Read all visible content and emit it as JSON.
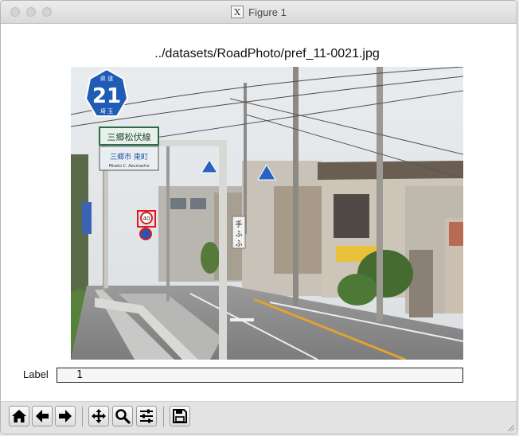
{
  "window": {
    "title": "Figure 1",
    "title_icon_glyph": "X"
  },
  "figure": {
    "title": "../datasets/RoadPhoto/pref_11-0021.jpg",
    "photo_description_name": "road-photo",
    "sign_text": {
      "route_top": "県 道",
      "route_number": "21",
      "route_bottom": "埼 玉",
      "sign_line1": "三郷松伏線",
      "sign_line2": "三郷市 東町",
      "sign_line3": "Misato C. Azumacho",
      "speed": "40",
      "side_sign1": "手",
      "side_sign2": "ふ",
      "side_sign3": "ふ"
    },
    "detection_box_color": "#e8141c"
  },
  "label": {
    "caption": "Label",
    "value": "1"
  },
  "toolbar": {
    "buttons": [
      {
        "name": "home-button",
        "icon": "home-icon"
      },
      {
        "name": "back-button",
        "icon": "arrow-left-icon"
      },
      {
        "name": "forward-button",
        "icon": "arrow-right-icon"
      },
      {
        "name": "pan-button",
        "icon": "move-icon"
      },
      {
        "name": "zoom-button",
        "icon": "zoom-icon"
      },
      {
        "name": "configure-subplots-button",
        "icon": "sliders-icon"
      },
      {
        "name": "save-button",
        "icon": "save-icon"
      }
    ]
  }
}
